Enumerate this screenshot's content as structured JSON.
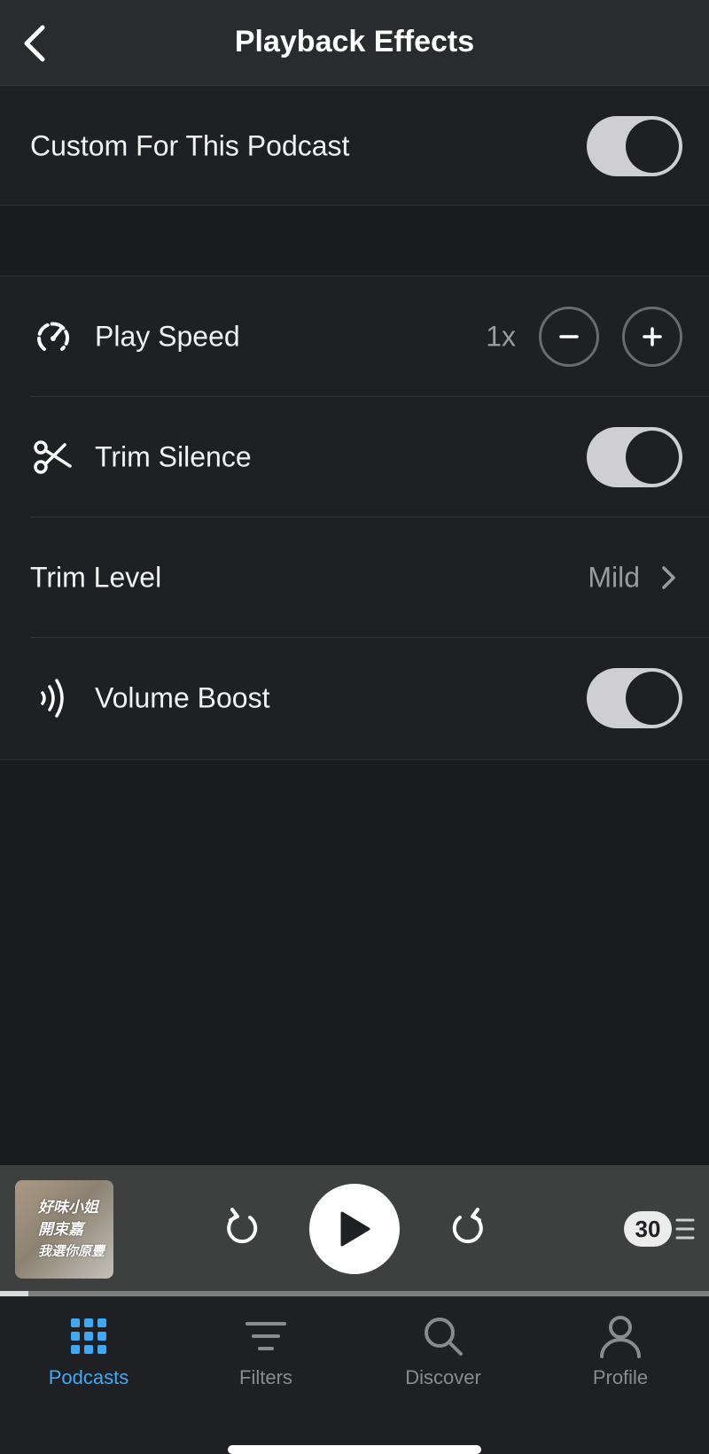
{
  "header": {
    "title": "Playback Effects",
    "back_icon": "chevron-left-icon"
  },
  "custom_section": {
    "label": "Custom For This Podcast",
    "toggle_on": true
  },
  "effects": {
    "play_speed": {
      "label": "Play Speed",
      "value": "1x",
      "icon": "speedometer-icon",
      "minus_icon": "minus-icon",
      "plus_icon": "plus-icon"
    },
    "trim_silence": {
      "label": "Trim Silence",
      "icon": "scissors-icon",
      "toggle_on": true
    },
    "trim_level": {
      "label": "Trim Level",
      "value": "Mild",
      "chevron_icon": "chevron-right-icon"
    },
    "volume_boost": {
      "label": "Volume Boost",
      "icon": "volume-waves-icon",
      "toggle_on": true
    }
  },
  "mini_player": {
    "artwork_text": [
      "好味小姐",
      "開束嘉",
      "我選你原豐"
    ],
    "skip_back_icon": "rotate-ccw-icon",
    "play_icon": "play-icon",
    "skip_forward_icon": "rotate-cw-icon",
    "up_next_count": "30",
    "progress": 0.04
  },
  "tabs": [
    {
      "label": "Podcasts",
      "icon": "grid-icon",
      "active": true
    },
    {
      "label": "Filters",
      "icon": "filter-icon",
      "active": false
    },
    {
      "label": "Discover",
      "icon": "search-icon",
      "active": false
    },
    {
      "label": "Profile",
      "icon": "person-icon",
      "active": false
    }
  ],
  "colors": {
    "accent": "#3fa9f5",
    "background": "#1a1b1d",
    "surface": "#1f2023",
    "player": "#3d403f",
    "toggle_track": "#cfcfd1"
  }
}
